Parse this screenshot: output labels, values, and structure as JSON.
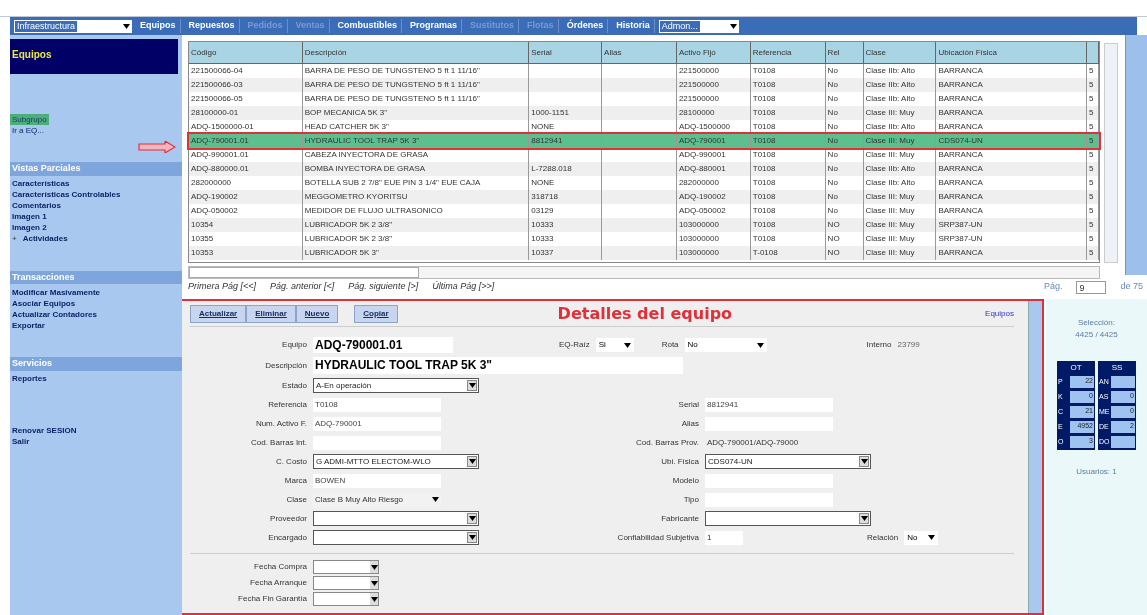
{
  "menu": {
    "module": "Infraestructura",
    "items": [
      {
        "label": "Equipos",
        "disabled": false
      },
      {
        "label": "Repuestos",
        "disabled": false
      },
      {
        "label": "Pedidos",
        "disabled": true
      },
      {
        "label": "Ventas",
        "disabled": true
      },
      {
        "label": "Combustibles",
        "disabled": false
      },
      {
        "label": "Programas",
        "disabled": false
      },
      {
        "label": "Sustitutos",
        "disabled": true
      },
      {
        "label": "Flotas",
        "disabled": true
      },
      {
        "label": "Órdenes",
        "disabled": false
      },
      {
        "label": "Historia",
        "disabled": false
      }
    ],
    "admin": "Admon..."
  },
  "sidebar": {
    "title": "Equipos",
    "links": [
      {
        "label": "Subgrupo",
        "selected": true
      },
      {
        "label": "Ir a EQ...",
        "selected": false
      }
    ],
    "sections": [
      {
        "title": "Vistas Parciales",
        "items": [
          {
            "label": "Características"
          },
          {
            "label": "Características Controlables"
          },
          {
            "label": "Comentarios"
          },
          {
            "label": "Imagen 1"
          },
          {
            "label": "Imagen 2"
          },
          {
            "label": "Actividades",
            "expander": "+"
          }
        ]
      },
      {
        "title": "Transacciones",
        "items": [
          {
            "label": "Modificar Masivamente"
          },
          {
            "label": "Asociar Equipos"
          },
          {
            "label": "Actualizar Contadores"
          },
          {
            "label": "Exportar"
          }
        ]
      },
      {
        "title": "Servicios",
        "items": [
          {
            "label": "Reportes"
          }
        ]
      }
    ],
    "footer": [
      "Renovar SESION",
      "Salir"
    ]
  },
  "table": {
    "columns": [
      "Código",
      "Descripción",
      "Serial",
      "Alias",
      "Activo Fijo",
      "Referencia",
      "Rel",
      "Clase",
      "Ubicación Física"
    ],
    "rows": [
      {
        "code": "221500066-04",
        "description": "BARRA DE PESO DE TUNGSTENO 5 ft 1 11/16\"",
        "fixed_asset": "221500000",
        "reference": "T0108",
        "rel": "No",
        "class": "Clase IIb: Alto",
        "location": "BARRANCA",
        "column_10": "5",
        "selected": false
      },
      {
        "code": "221500066-03",
        "description": "BARRA DE PESO DE TUNGSTENO 5 ft 1 11/16\"",
        "fixed_asset": "221500000",
        "reference": "T0108",
        "rel": "No",
        "class": "Clase IIb: Alto",
        "location": "BARRANCA",
        "column_10": "5",
        "selected": false
      },
      {
        "code": "221500066-05",
        "description": "BARRA DE PESO DE TUNGSTENO 5 ft 1 11/16\"",
        "fixed_asset": "221500000",
        "reference": "T0108",
        "rel": "No",
        "class": "Clase IIb: Alto",
        "location": "BARRANCA",
        "column_10": "5",
        "selected": false
      },
      {
        "code": "28100000-01",
        "description": "BOP MECANICA 5K 3\"",
        "serial": "1000-1151",
        "fixed_asset": "28100000",
        "reference": "T0108",
        "rel": "No",
        "class": "Clase III: Muy",
        "location": "BARRANCA",
        "column_10": "5",
        "selected": false
      },
      {
        "code": "ADQ-1500000-01",
        "description": "HEAD CATCHER 5K 3\"",
        "serial": "NONE",
        "fixed_asset": "ADQ-1500000",
        "reference": "T0108",
        "rel": "No",
        "class": "Clase IIb: Alto",
        "location": "BARRANCA",
        "column_10": "5",
        "selected": false
      },
      {
        "code": "ADQ-790001.01",
        "description": "HYDRAULIC TOOL TRAP 5K 3\"",
        "serial": "8812941",
        "fixed_asset": "ADQ-790001",
        "reference": "T0108",
        "rel": "No",
        "class": "Clase III: Muy",
        "location": "CDS074-UN",
        "column_10": "5",
        "selected": true
      },
      {
        "code": "ADQ-990001.01",
        "description": "CABEZA INYECTORA DE GRASA",
        "fixed_asset": "ADQ-990001",
        "reference": "T0108",
        "rel": "No",
        "class": "Clase III: Muy",
        "location": "BARRANCA",
        "column_10": "5",
        "selected": false
      },
      {
        "code": "ADQ-880000.01",
        "description": "BOMBA INYECTORA DE GRASA",
        "serial": "L-7288.018",
        "fixed_asset": "ADQ-880001",
        "reference": "T0108",
        "rel": "No",
        "class": "Clase IIb: Alto",
        "location": "BARRANCA",
        "column_10": "5",
        "selected": false
      },
      {
        "code": "282000000",
        "description": "BOTELLA SUB 2 7/8\"  EUE PIN 3 1/4\" EUE CAJA",
        "serial": "NONE",
        "fixed_asset": "282000000",
        "reference": "T0108",
        "rel": "No",
        "class": "Clase IIb: Alto",
        "location": "BARRANCA",
        "column_10": "5",
        "selected": false
      },
      {
        "code": "ADQ-190002",
        "description": "MEGGOMETRO KYORITSU",
        "serial": "318718",
        "fixed_asset": "ADQ-190002",
        "reference": "T0108",
        "rel": "No",
        "class": "Clase III: Muy",
        "location": "BARRANCA",
        "column_10": "5",
        "selected": false
      },
      {
        "code": "ADQ-050002",
        "description": "MEDIDOR DE FLUJO ULTRASONICO",
        "serial": "03129",
        "fixed_asset": "ADQ-050002",
        "reference": "T0108",
        "rel": "No",
        "class": "Clase III: Muy",
        "location": "BARRANCA",
        "column_10": "5",
        "selected": false
      },
      {
        "code": "10354",
        "description": "LUBRICADOR 5K 2 3/8\"",
        "serial": "10333",
        "fixed_asset": "103000000",
        "reference": "T0108",
        "rel": "NO",
        "class": "Clase III: Muy",
        "location": "SRP387-UN",
        "column_10": "5",
        "selected": false
      },
      {
        "code": "10355",
        "description": "LUBRICADOR 5K 2 3/8\"",
        "serial": "10333",
        "fixed_asset": "103000000",
        "reference": "T0108",
        "rel": "NO",
        "class": "Clase III: Muy",
        "location": "SRP387-UN",
        "column_10": "5",
        "selected": false
      },
      {
        "code": "10353",
        "description": "LUBRICADOR 5K 3\"",
        "serial": "10337",
        "fixed_asset": "103000000",
        "reference": "T-0108",
        "rel": "NO",
        "class": "Clase III: Muy",
        "location": "BARRANCA",
        "column_10": "5",
        "selected": false
      }
    ]
  },
  "pager": {
    "links": [
      "Primera Pág [<<]",
      "Pág. anterior [<]",
      "Pág. siguiente [>]",
      "Última Pág [>>]"
    ],
    "page_label": "Pág.",
    "page": "9",
    "total": "de 75"
  },
  "details": {
    "buttons": [
      "Actualizar",
      "Eliminar",
      "Nuevo",
      "Copiar"
    ],
    "title": "Detalles del equipo",
    "link": "Equipos",
    "equipo": {
      "label": "Equipo",
      "value": "ADQ-790001.01"
    },
    "eq_raiz": {
      "label": "EQ-Raíz",
      "value": "Si"
    },
    "rota": {
      "label": "Rota",
      "value": "No"
    },
    "interno": {
      "label": "Interno",
      "value": "23799"
    },
    "descripcion": {
      "label": "Descripción",
      "value": "HYDRAULIC TOOL TRAP 5K 3\""
    },
    "rows": [
      {
        "left": {
          "label": "Estado",
          "value": "A-En operación",
          "kind": "dropdown"
        }
      },
      {
        "left": {
          "label": "Referencia",
          "value": "T0108",
          "kind": "input"
        },
        "right": {
          "label": "Serial",
          "value": "8812941",
          "kind": "input"
        }
      },
      {
        "left": {
          "label": "Num. Activo F.",
          "value": "ADQ-790001",
          "kind": "input"
        },
        "right": {
          "label": "Alias",
          "kind": "input"
        }
      },
      {
        "left": {
          "label": "Cod. Barras Int.",
          "kind": "input"
        },
        "right": {
          "label": "Cod. Barras Prov.",
          "value": "ADQ-790001/ADQ-79000",
          "kind": "text"
        }
      },
      {
        "left": {
          "label": "C. Costo",
          "value": "G ADMI-MTTO ELECTOM-WLO",
          "kind": "dropdown"
        },
        "right": {
          "label": "Ubi. Física",
          "value": "CDS074-UN",
          "kind": "dropdown"
        }
      },
      {
        "left": {
          "label": "Marca",
          "value": "BOWEN",
          "kind": "input"
        },
        "right": {
          "label": "Modelo",
          "kind": "input"
        }
      },
      {
        "left": {
          "label": "Clase",
          "value": "Clase B Muy Alto Riesgo",
          "kind": "combo"
        },
        "right": {
          "label": "Tipo",
          "kind": "input"
        }
      },
      {
        "left": {
          "label": "Proveedor",
          "kind": "dropdown"
        },
        "right": {
          "label": "Fabricante",
          "kind": "dropdown"
        }
      },
      {
        "left": {
          "label": "Encargado",
          "kind": "dropdown"
        },
        "right": {
          "label": "Confiabilidad Subjetiva",
          "value": "1",
          "kind": "short"
        },
        "extra": {
          "label": "Relación",
          "value": "No"
        }
      }
    ],
    "dates": [
      {
        "label": "Fecha Compra"
      },
      {
        "label": "Fecha Arranque"
      },
      {
        "label": "Fecha Fin Garantía"
      }
    ]
  },
  "summary": {
    "selection_label": "Selección:",
    "selection": "4425 / 4425",
    "ot": {
      "title": "OT",
      "rows": [
        {
          "key": "P",
          "value": "22"
        },
        {
          "key": "K",
          "value": "0"
        },
        {
          "key": "C",
          "value": "21"
        },
        {
          "key": "E",
          "value": "4952"
        },
        {
          "key": "O",
          "value": "3"
        }
      ]
    },
    "ss": {
      "title": "SS",
      "rows": [
        {
          "key": "AN"
        },
        {
          "key": "AS",
          "value": "0"
        },
        {
          "key": "ME",
          "value": "0"
        },
        {
          "key": "DE",
          "value": "2"
        },
        {
          "key": "DO"
        }
      ]
    },
    "users": "Usuarios: 1"
  }
}
